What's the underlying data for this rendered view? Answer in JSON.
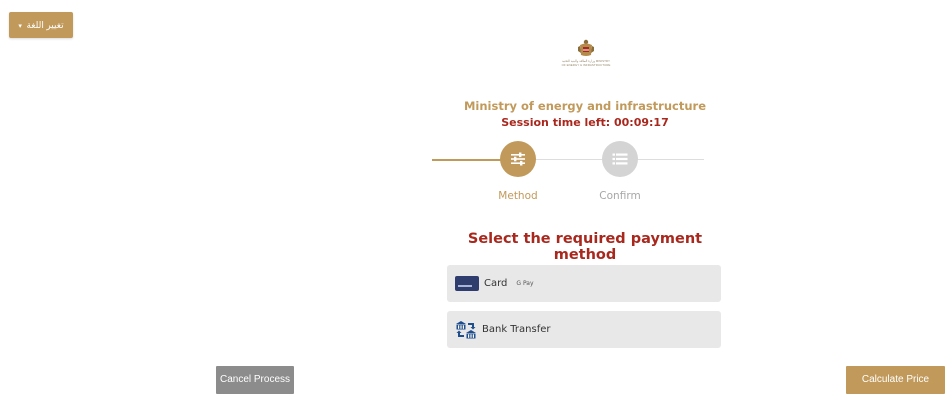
{
  "header": {
    "language_button_label": "تغيير اللغة",
    "language_caret": "▾"
  },
  "emblem": {
    "icon": "uae-emblem-icon",
    "caption": "وزارة الطاقة والبنية التحتية MINISTRY OF ENERGY & INFRASTRUCTURE"
  },
  "main": {
    "ministry_title": "Ministry of energy and infrastructure",
    "session_text": "Session time left: 00:09:17",
    "steps": [
      {
        "label": "Method",
        "icon": "sliders-icon",
        "active": true
      },
      {
        "label": "Confirm",
        "icon": "list-icon",
        "active": false
      }
    ],
    "heading": "Select the required payment method",
    "payment_options": [
      {
        "label": "Card",
        "secondary_label": "G Pay",
        "icon": "credit-card-icon"
      },
      {
        "label": "Bank Transfer",
        "icon": "bank-transfer-icon"
      }
    ]
  },
  "footer": {
    "cancel_label": "Cancel Process",
    "calculate_label": "Calculate Price"
  },
  "colors": {
    "gold": "#c19a5b",
    "maroon": "#a8281e",
    "inactive_step": "#d4d4d4",
    "option_bg": "#e8e8e8",
    "cancel_bg": "#8c8c8c"
  }
}
